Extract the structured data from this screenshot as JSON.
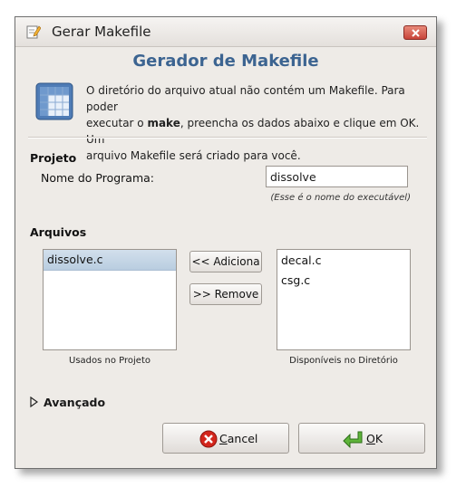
{
  "window": {
    "title": "Gerar Makefile"
  },
  "header": {
    "heading": "Gerador de Makefile",
    "info_line1": "O diretório do arquivo atual não contém um Makefile. Para poder",
    "info_line2_pre": "executar o ",
    "info_line2_bold": "make",
    "info_line2_post": ", preencha os dados abaixo e clique em OK. Um",
    "info_line3": "arquivo Makefile será criado para você."
  },
  "project": {
    "section_label": "Projeto",
    "program_label": "Nome do Programa:",
    "program_value": "dissolve",
    "hint": "(Esse é o nome do executável)"
  },
  "files": {
    "section_label": "Arquivos",
    "used_items": [
      "dissolve.c"
    ],
    "available_items": [
      "decal.c",
      "csg.c"
    ],
    "add_label": "<< Adiciona",
    "remove_label": ">> Remove",
    "used_caption": "Usados no Projeto",
    "available_caption": "Disponíveis no Diretório"
  },
  "advanced": {
    "label": "Avançado"
  },
  "buttons": {
    "cancel_first": "C",
    "cancel_rest": "ancel",
    "ok_first": "O",
    "ok_rest": "K"
  },
  "icons": {
    "title": "edit-icon",
    "close": "close-icon",
    "info": "grid-document-icon",
    "expander": "triangle-right-icon",
    "cancel": "cancel-icon",
    "ok": "return-arrow-icon"
  },
  "colors": {
    "heading": "#3c6491",
    "close": "#c8453a",
    "selection": "#c6d6e6"
  }
}
